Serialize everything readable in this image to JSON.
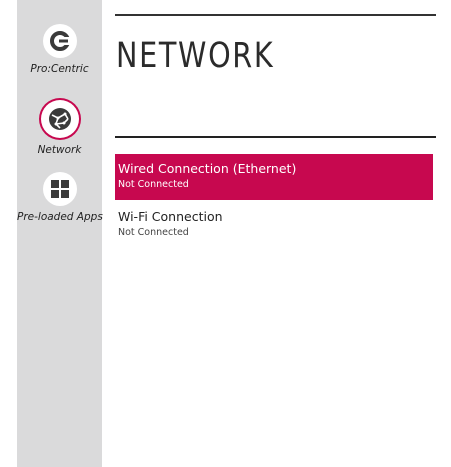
{
  "sidebar": {
    "items": [
      {
        "label": "Pro:Centric",
        "icon": "procentric-logo-icon",
        "selected": false
      },
      {
        "label": "Network",
        "icon": "globe-network-icon",
        "selected": true
      },
      {
        "label": "Pre-loaded Apps",
        "icon": "apps-grid-icon",
        "selected": false
      }
    ]
  },
  "main": {
    "title": "NETWORK",
    "connections": [
      {
        "name": "Wired Connection (Ethernet)",
        "status": "Not Connected",
        "selected": true
      },
      {
        "name": "Wi-Fi Connection",
        "status": "Not Connected",
        "selected": false
      }
    ]
  },
  "colors": {
    "accent": "#c7084f",
    "sidebar_bg": "#dadadb"
  }
}
